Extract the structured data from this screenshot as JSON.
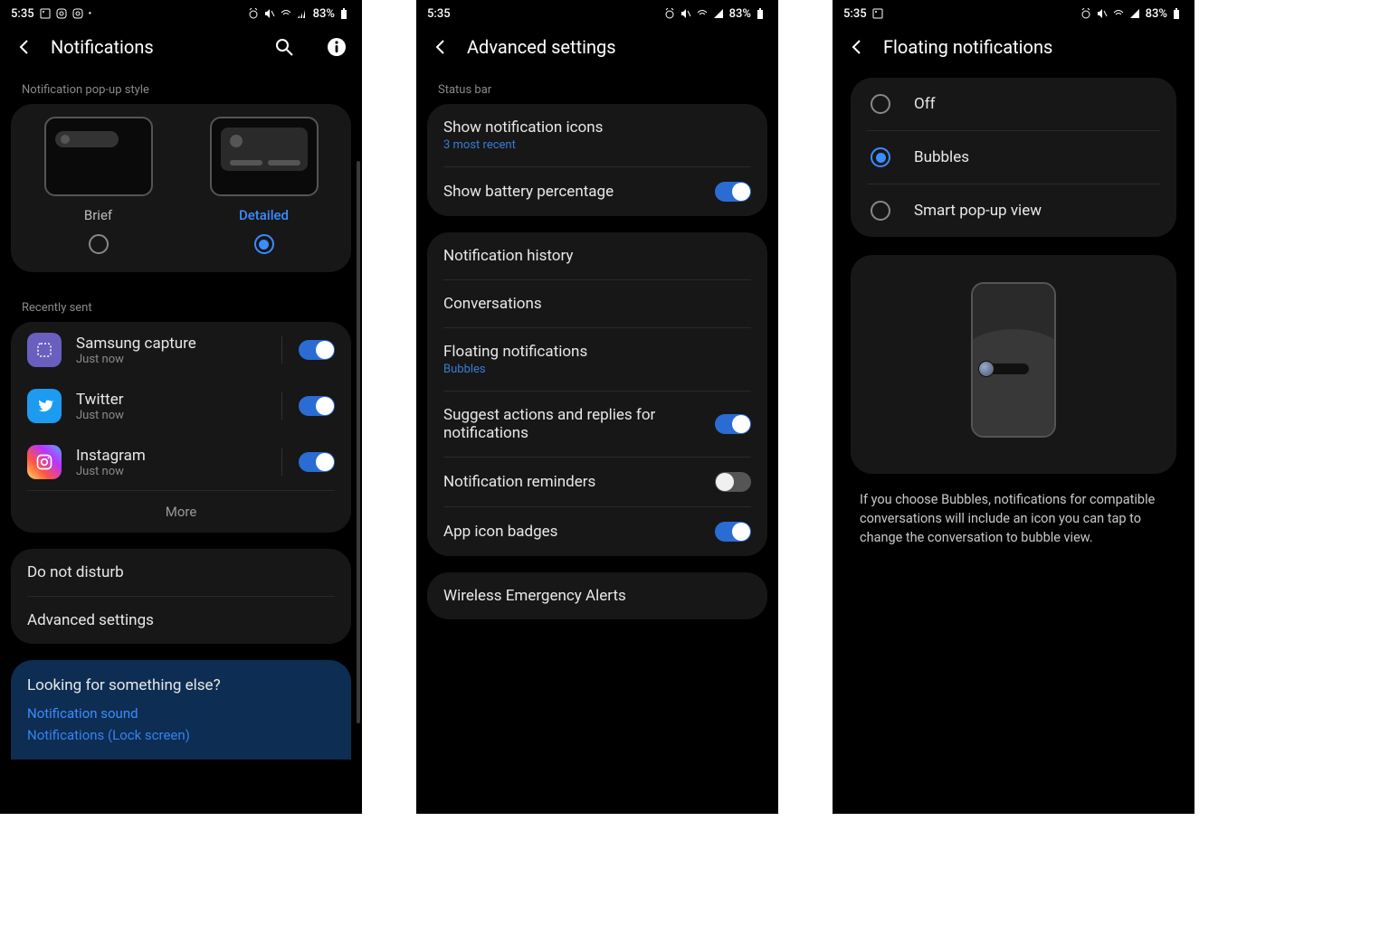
{
  "status": {
    "time": "5:35",
    "battery": "83%"
  },
  "screen1": {
    "title": "Notifications",
    "popup_section": "Notification pop-up style",
    "popup_brief": "Brief",
    "popup_detailed": "Detailed",
    "recent_section": "Recently sent",
    "apps": [
      {
        "name": "Samsung capture",
        "sub": "Just now",
        "icon": "samsung-capture",
        "on": true
      },
      {
        "name": "Twitter",
        "sub": "Just now",
        "icon": "twitter",
        "on": true
      },
      {
        "name": "Instagram",
        "sub": "Just now",
        "icon": "instagram",
        "on": true
      }
    ],
    "more": "More",
    "dnd": "Do not disturb",
    "advanced": "Advanced settings",
    "footer_q": "Looking for something else?",
    "footer_link1": "Notification sound",
    "footer_link2": "Notifications (Lock screen)"
  },
  "screen2": {
    "title": "Advanced settings",
    "statusbar_section": "Status bar",
    "show_icons": "Show notification icons",
    "show_icons_sub": "3 most recent",
    "show_battery": "Show battery percentage",
    "history": "Notification history",
    "conversations": "Conversations",
    "floating": "Floating notifications",
    "floating_sub": "Bubbles",
    "suggest": "Suggest actions and replies for notifications",
    "reminders": "Notification reminders",
    "badges": "App icon badges",
    "wea": "Wireless Emergency Alerts"
  },
  "screen3": {
    "title": "Floating notifications",
    "opt_off": "Off",
    "opt_bubbles": "Bubbles",
    "opt_smart": "Smart pop-up view",
    "desc": "If you choose Bubbles, notifications for compatible conversations will include an icon you can tap to change the conversation to bubble view."
  }
}
